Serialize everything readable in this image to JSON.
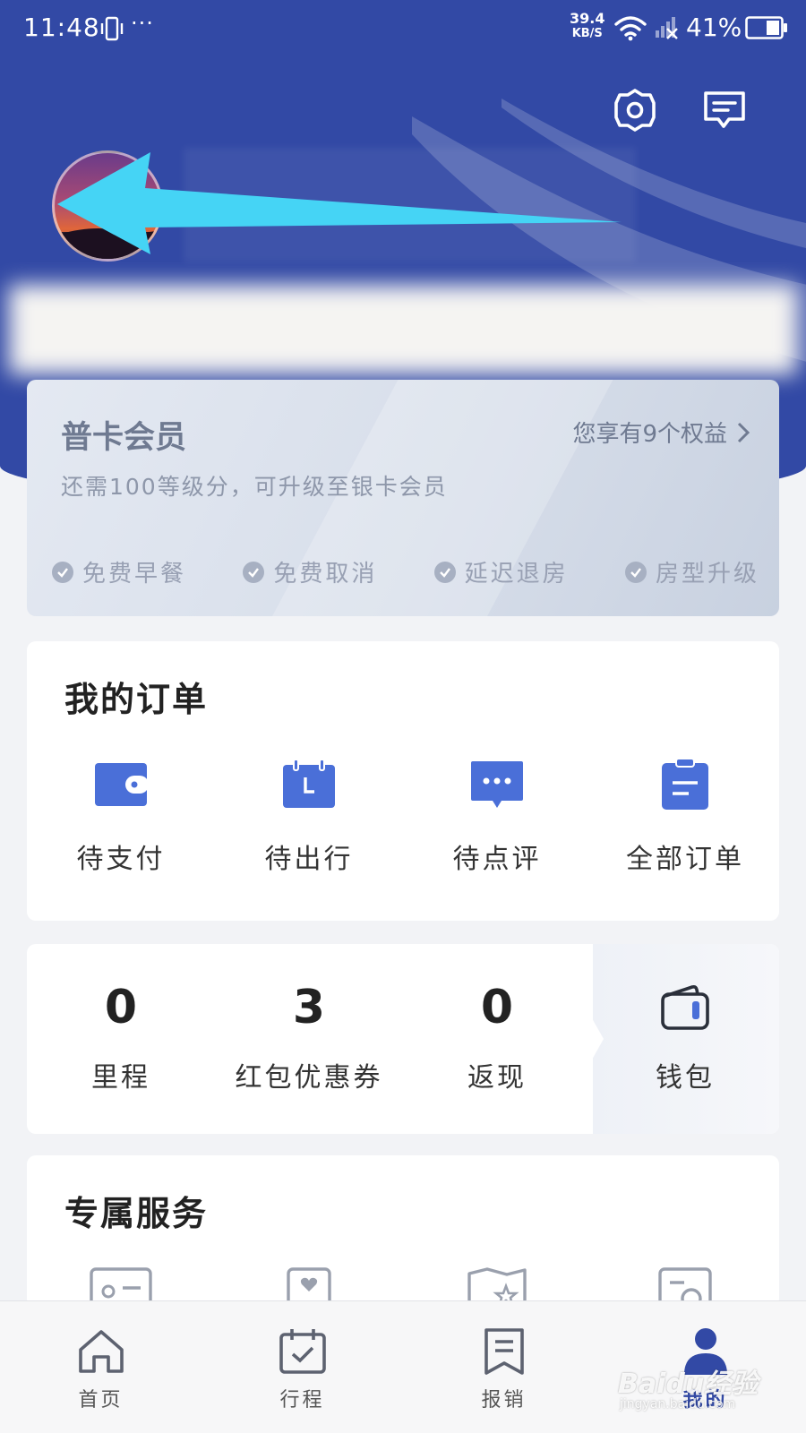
{
  "status_bar": {
    "time": "11:48",
    "more": "···",
    "speed_value": "39.4",
    "speed_unit": "KB/S",
    "battery": "41%"
  },
  "header": {
    "icons": [
      "settings-icon",
      "message-icon"
    ]
  },
  "member_card": {
    "title": "普卡会员",
    "benefits_link": "您享有9个权益",
    "subtitle": "还需100等级分，可升级至银卡会员",
    "perks": [
      "免费早餐",
      "免费取消",
      "延迟退房",
      "房型升级"
    ]
  },
  "orders": {
    "title": "我的订单",
    "items": [
      {
        "label": "待支付",
        "icon": "wallet-icon"
      },
      {
        "label": "待出行",
        "icon": "calendar-icon"
      },
      {
        "label": "待点评",
        "icon": "comment-icon"
      },
      {
        "label": "全部订单",
        "icon": "clipboard-icon"
      }
    ]
  },
  "assets": {
    "items": [
      {
        "value": "0",
        "label": "里程"
      },
      {
        "value": "3",
        "label": "红包优惠券"
      },
      {
        "value": "0",
        "label": "返现"
      }
    ],
    "wallet_label": "钱包"
  },
  "services": {
    "title": "专属服务"
  },
  "tab_bar": {
    "tabs": [
      {
        "label": "首页",
        "icon": "home-icon"
      },
      {
        "label": "行程",
        "icon": "trip-calendar-icon"
      },
      {
        "label": "报销",
        "icon": "receipt-icon"
      },
      {
        "label": "我的",
        "icon": "profile-icon"
      }
    ],
    "active_index": 3
  },
  "watermark": {
    "brand": "Baidu经验",
    "url": "jingyan.baidu.com"
  },
  "colors": {
    "brand_blue": "#3249a5",
    "icon_blue": "#4a6fd8",
    "annotation_arrow": "#45d4f5"
  }
}
